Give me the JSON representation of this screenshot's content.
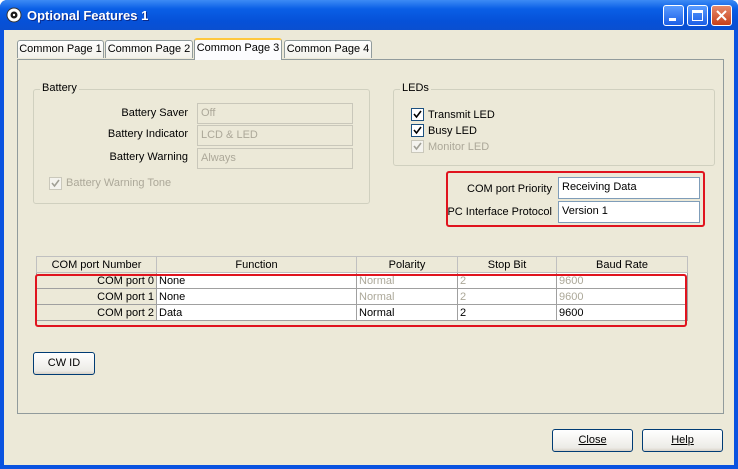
{
  "window": {
    "title": "Optional Features 1",
    "icon": "app-disc-icon"
  },
  "tabs": [
    {
      "label": "Common Page 1",
      "active": false
    },
    {
      "label": "Common Page 2",
      "active": false
    },
    {
      "label": "Common Page 3",
      "active": true
    },
    {
      "label": "Common Page 4",
      "active": false
    }
  ],
  "battery": {
    "group_title": "Battery",
    "saver_label": "Battery Saver",
    "saver_value": "Off",
    "indicator_label": "Battery Indicator",
    "indicator_value": "LCD & LED",
    "warning_label": "Battery Warning",
    "warning_value": "Always",
    "tone_label": "Battery Warning Tone",
    "tone_checked": true
  },
  "leds": {
    "group_title": "LEDs",
    "transmit_label": "Transmit LED",
    "busy_label": "Busy LED",
    "monitor_label": "Monitor LED"
  },
  "com": {
    "priority_label": "COM port Priority",
    "priority_value": "Receiving Data",
    "protocol_label": "PC Interface Protocol",
    "protocol_value": "Version 1"
  },
  "table": {
    "headers": [
      "COM port Number",
      "Function",
      "Polarity",
      "Stop Bit",
      "Baud Rate"
    ],
    "rows": [
      {
        "port": "COM port 0",
        "function": "None",
        "polarity": "Normal",
        "stop_bit": "2",
        "baud": "9600"
      },
      {
        "port": "COM port 1",
        "function": "None",
        "polarity": "Normal",
        "stop_bit": "2",
        "baud": "9600"
      },
      {
        "port": "COM port 2",
        "function": "Data",
        "polarity": "Normal",
        "stop_bit": "2",
        "baud": "9600"
      }
    ]
  },
  "buttons": {
    "cwid": "CW ID",
    "close": "Close",
    "help": "Help"
  },
  "colors": {
    "highlight": "#e0141e",
    "titlebar": "#0a5fe6"
  }
}
